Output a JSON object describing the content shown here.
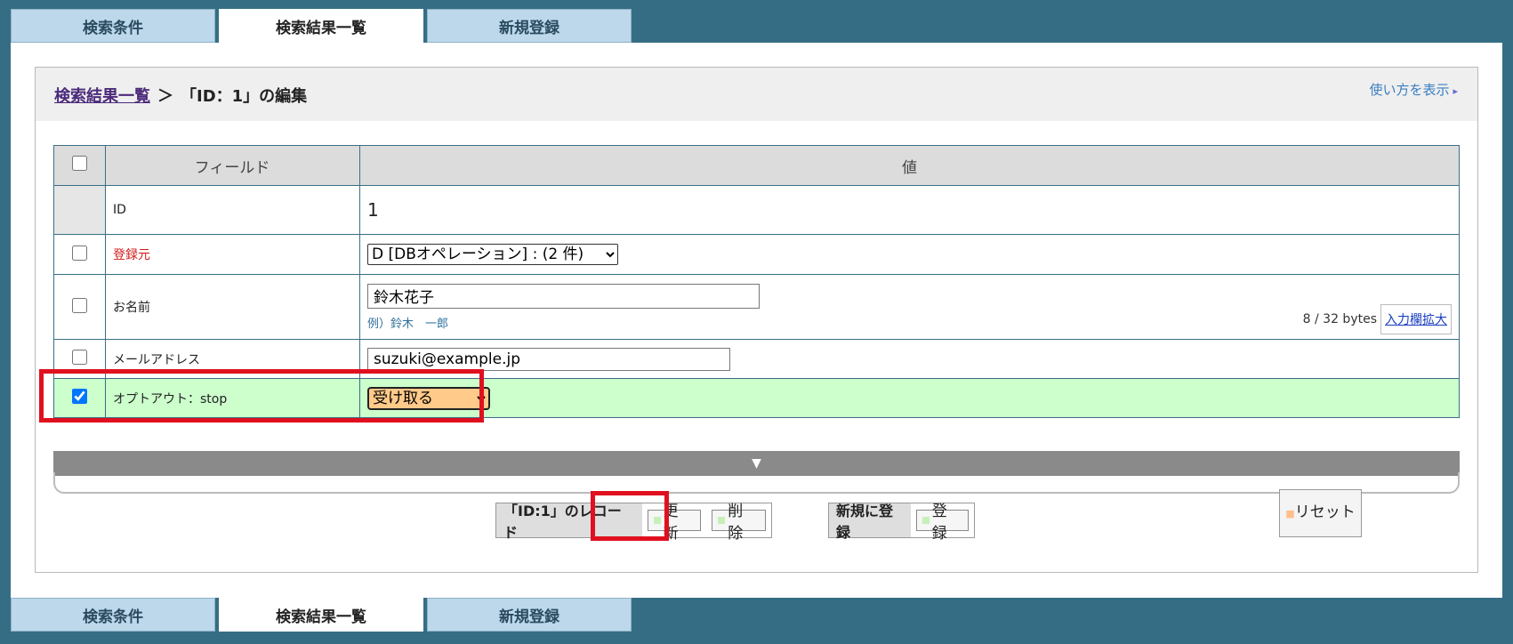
{
  "tabs": [
    "検索条件",
    "検索結果一覧",
    "新規登録"
  ],
  "breadcrumb": {
    "link": "検索結果一覧",
    "sep": "＞",
    "current": "「ID：1」の編集"
  },
  "help": {
    "label": "使い方を表示",
    "arrow": "▸"
  },
  "table": {
    "header_field": "フィールド",
    "header_value": "値",
    "id_label": "ID",
    "id_value": "1",
    "source_label": "登録元",
    "source_value": "D [DBオペレーション] : (2 件)",
    "name_label": "お名前",
    "name_value": "鈴木花子",
    "name_hint": "例）鈴木　一郎",
    "name_counter": "8 / 32 bytes",
    "expand_label": "入力欄拡大",
    "email_label": "メールアドレス",
    "email_value": "suzuki@example.jp",
    "optout_label": "オプトアウト：stop",
    "optout_value": "受け取る"
  },
  "expander_arrow": "▼",
  "reset_label": "リセット",
  "record_actions": {
    "label": "「ID:1」のレコード",
    "update": "更新",
    "delete": "削除"
  },
  "new_actions": {
    "label": "新規に登録",
    "register": "登録"
  },
  "colors": {
    "accent": "#356e84",
    "highlight": "#e0101f",
    "row_selected": "#ccffcc"
  }
}
